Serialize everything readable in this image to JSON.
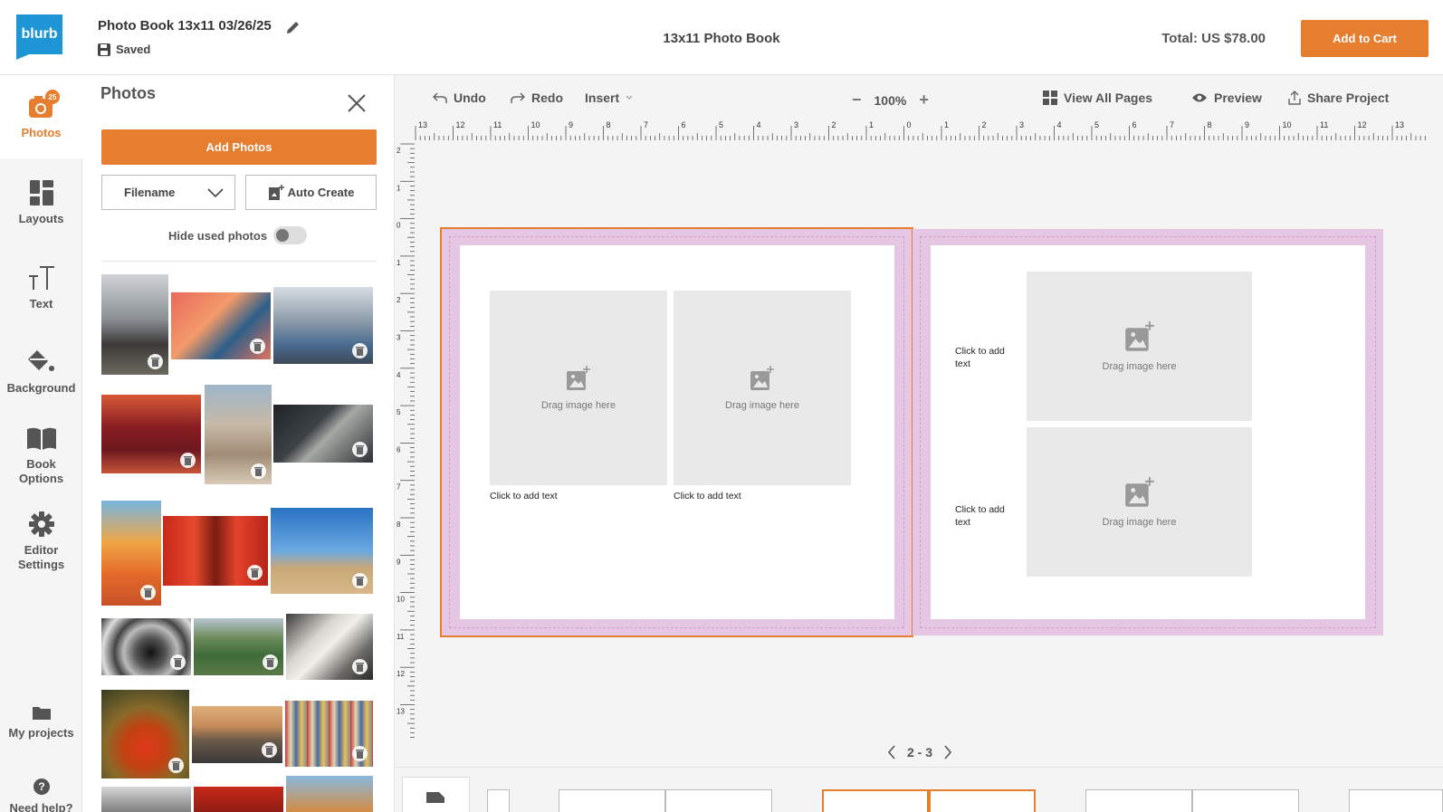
{
  "header": {
    "logo_text": "blurb",
    "project_title": "Photo Book 13x11 03/26/25",
    "save_status": "Saved",
    "book_type": "13x11 Photo Book",
    "total": "Total: US $78.00",
    "add_to_cart": "Add to Cart",
    "brand_color": "#1e96d6",
    "accent_color": "#e57e2e"
  },
  "rail": {
    "items": [
      {
        "label": "Photos",
        "icon": "camera-icon",
        "badge": "25"
      },
      {
        "label": "Layouts",
        "icon": "layouts-icon"
      },
      {
        "label": "Text",
        "icon": "text-icon"
      },
      {
        "label": "Background",
        "icon": "paint-bucket-icon"
      },
      {
        "label": "Book Options",
        "icon": "book-icon"
      },
      {
        "label": "Editor Settings",
        "icon": "gear-icon"
      },
      {
        "label": "My projects",
        "icon": "folder-icon"
      },
      {
        "label": "Need help?",
        "icon": "help-icon"
      }
    ]
  },
  "panel": {
    "title": "Photos",
    "add_photos": "Add Photos",
    "sort_value": "Filename",
    "auto_create": "Auto Create",
    "hide_used": "Hide used photos"
  },
  "toolbar": {
    "undo": "Undo",
    "redo": "Redo",
    "insert": "Insert",
    "zoom": "100%",
    "view_all": "View All Pages",
    "preview": "Preview",
    "share": "Share Project"
  },
  "ruler": {
    "top_labels": [
      "13",
      "12",
      "11",
      "10",
      "9",
      "8",
      "7",
      "6",
      "5",
      "4",
      "3",
      "2",
      "1",
      "0",
      "1",
      "2",
      "3",
      "4",
      "5",
      "6",
      "7",
      "8",
      "9",
      "10",
      "11",
      "12",
      "13"
    ],
    "left_labels": [
      "2",
      "1",
      "0",
      "1",
      "2",
      "3",
      "4",
      "5",
      "6",
      "7",
      "8",
      "9",
      "10",
      "11",
      "12",
      "13"
    ]
  },
  "canvas": {
    "drag_text": "Drag image here",
    "caption_text": "Click to add text",
    "side_caption": [
      "Click to add",
      "text"
    ],
    "page_range": "2 - 3"
  }
}
